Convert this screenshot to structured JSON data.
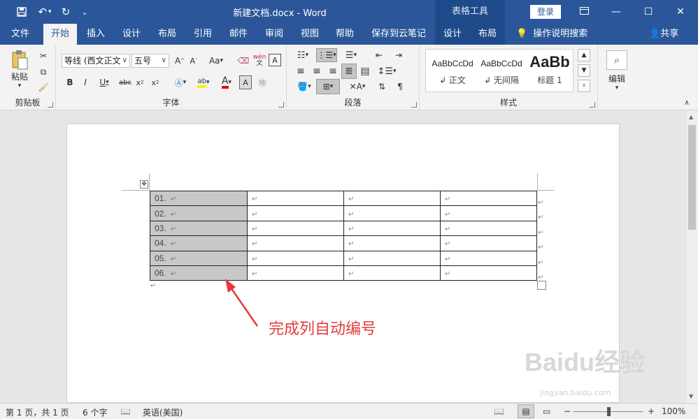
{
  "titlebar": {
    "doc_title": "新建文档.docx  -  Word",
    "context_group": "表格工具",
    "login": "登录"
  },
  "tabs": [
    "文件",
    "开始",
    "插入",
    "设计",
    "布局",
    "引用",
    "邮件",
    "审阅",
    "视图",
    "帮助",
    "保存到云笔记",
    "设计",
    "布局"
  ],
  "tell_me": "操作说明搜索",
  "share": "共享",
  "ribbon": {
    "clipboard": {
      "paste": "粘贴",
      "label": "剪贴板"
    },
    "font": {
      "name": "等线 (西文正文",
      "size": "五号",
      "aa": "Aa",
      "wen": "wén",
      "label": "字体"
    },
    "paragraph": {
      "label": "段落"
    },
    "styles": {
      "items": [
        {
          "sample": "AaBbCcDd",
          "name": "↲ 正文"
        },
        {
          "sample": "AaBbCcDd",
          "name": "↲ 无间隔"
        },
        {
          "sample": "AaBb",
          "name": "标题 1"
        }
      ],
      "label": "样式"
    },
    "edit": {
      "label": "编辑"
    }
  },
  "table": {
    "rows": [
      "01.",
      "02.",
      "03.",
      "04.",
      "05.",
      "06."
    ]
  },
  "annotation": "完成列自动编号",
  "watermark": {
    "main": "Baidu经验",
    "sub": "jingyan.baidu.com"
  },
  "status": {
    "page": "第 1 页，共 1 页",
    "words": "6 个字",
    "lang": "英语(美国)",
    "zoom": "100%"
  }
}
